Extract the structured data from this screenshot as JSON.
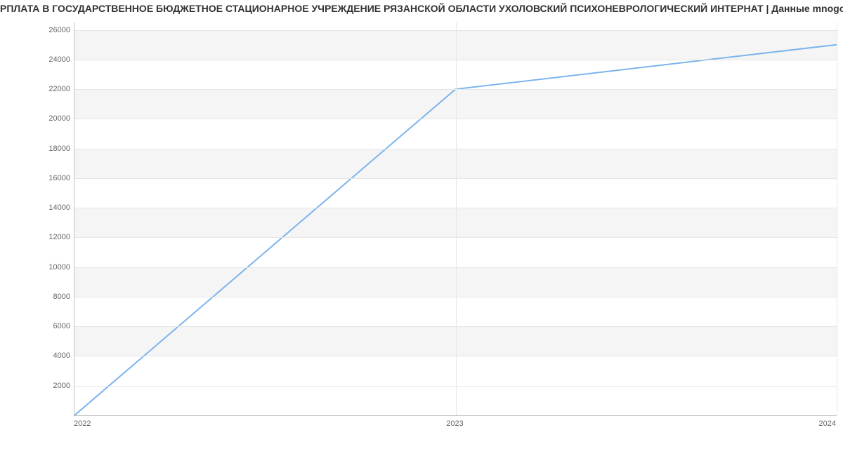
{
  "title": "РПЛАТА В ГОСУДАРСТВЕННОЕ БЮДЖЕТНОЕ СТАЦИОНАРНОЕ УЧРЕЖДЕНИЕ РЯЗАНСКОЙ ОБЛАСТИ УХОЛОВСКИЙ ПСИХОНЕВРОЛОГИЧЕСКИЙ ИНТЕРНАТ | Данные mnogo.wo",
  "chart_data": {
    "type": "line",
    "x": [
      2022,
      2023,
      2024
    ],
    "x_labels": [
      "2022",
      "2023",
      "2024"
    ],
    "values": [
      0,
      22000,
      25000
    ],
    "y_ticks": [
      2000,
      4000,
      6000,
      8000,
      10000,
      12000,
      14000,
      16000,
      18000,
      20000,
      22000,
      24000,
      26000
    ],
    "ylim": [
      0,
      26500
    ],
    "xlim": [
      2022,
      2024
    ],
    "series_color": "#7cb5ec",
    "band_color": "#f5f5f5"
  }
}
